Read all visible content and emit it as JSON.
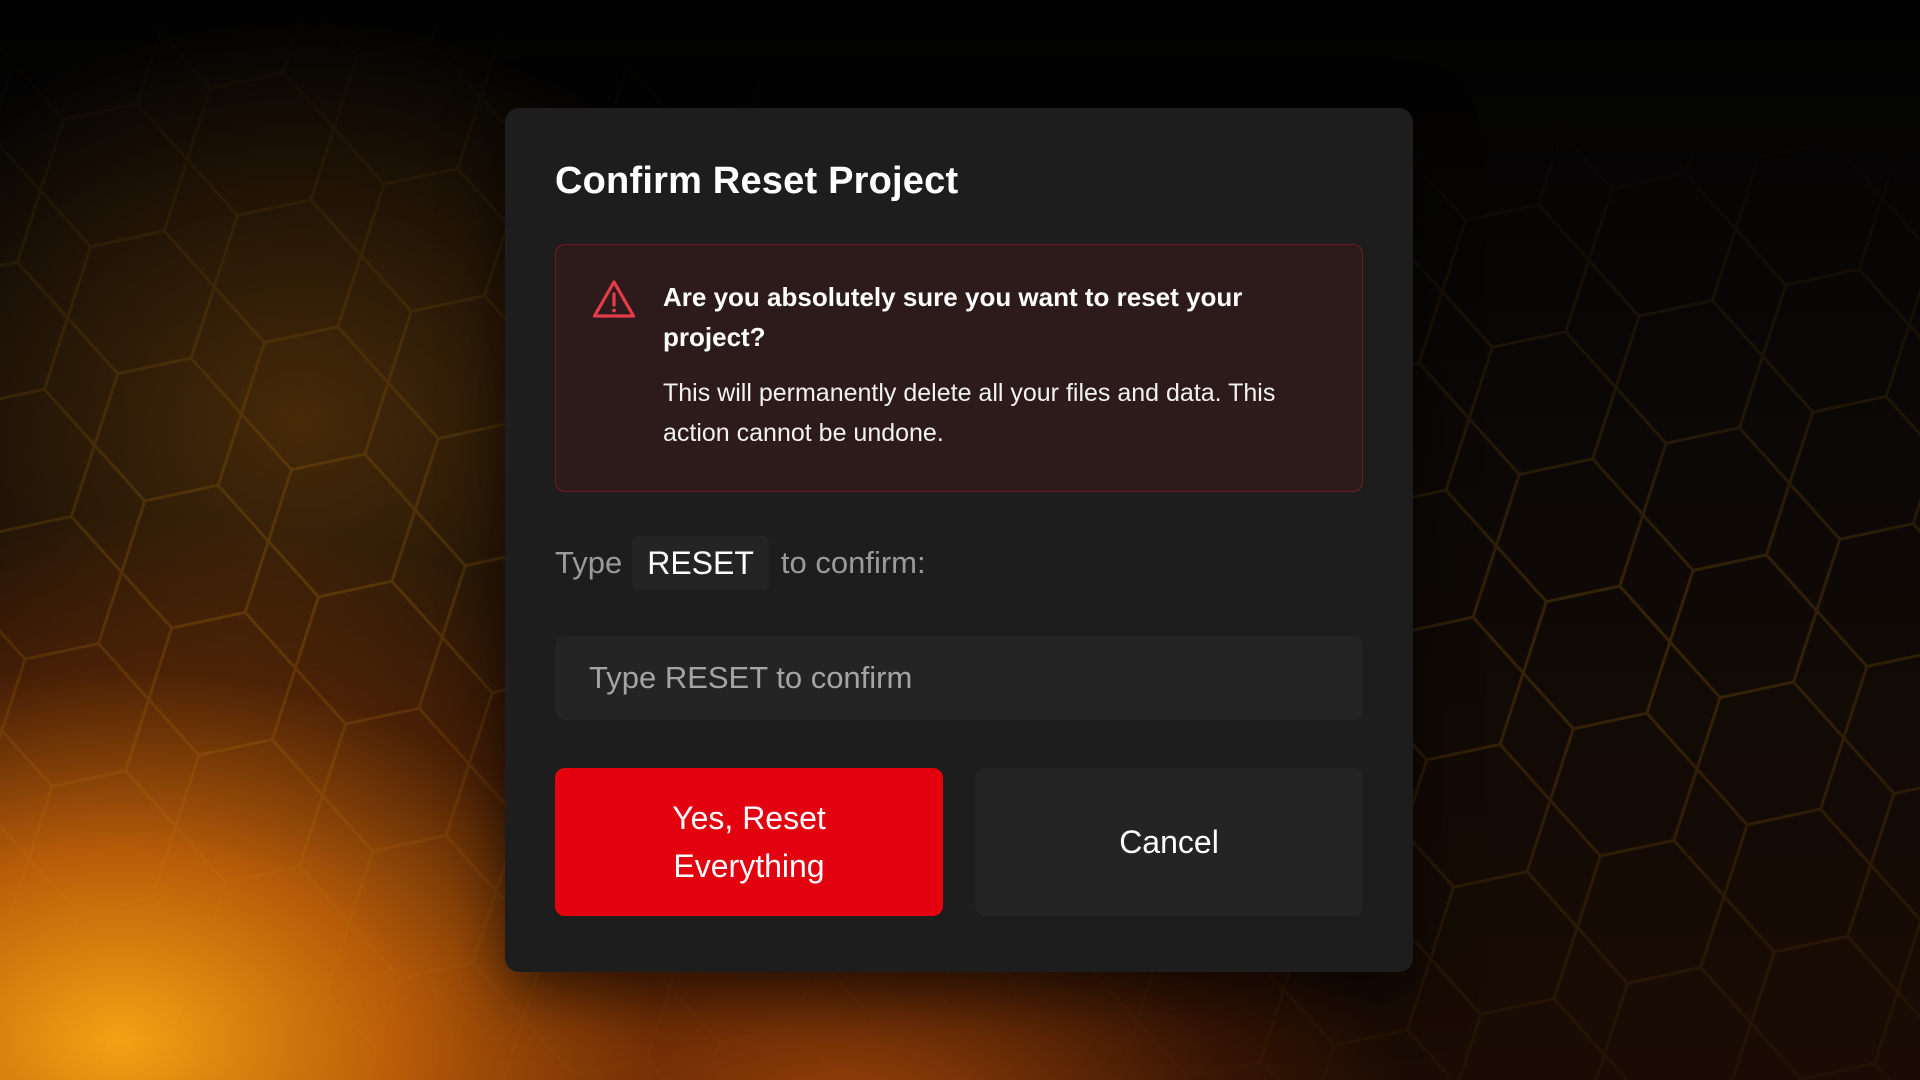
{
  "dialog": {
    "title": "Confirm Reset Project",
    "warning": {
      "icon": "alert-triangle-icon",
      "heading": "Are you absolutely sure you want to reset your project?",
      "body": "This will permanently delete all your files and data. This action cannot be undone."
    },
    "confirm_prompt": {
      "prefix": "Type",
      "code": "RESET",
      "suffix": "to confirm:"
    },
    "input": {
      "value": "",
      "placeholder": "Type RESET to confirm"
    },
    "buttons": {
      "confirm_label": "Yes, Reset Everything",
      "cancel_label": "Cancel"
    }
  },
  "colors": {
    "danger": "#e3000f",
    "modal_background": "#1d1d1d",
    "warning_background": "#2d1a1b",
    "warning_border": "#6a1f24",
    "accent_glow": "#ff9a10"
  }
}
